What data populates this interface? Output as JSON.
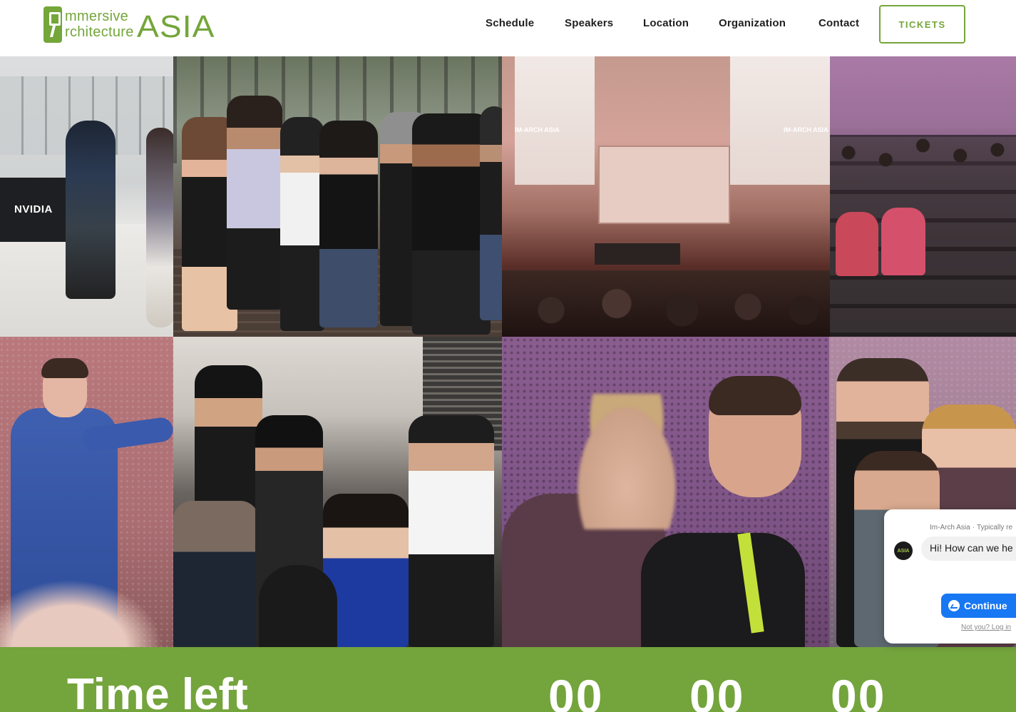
{
  "header": {
    "logo": {
      "line1": "mmersive",
      "line2": "rchitecture",
      "asia": "ASIA"
    },
    "nav": [
      {
        "label": "Schedule"
      },
      {
        "label": "Speakers"
      },
      {
        "label": "Location"
      },
      {
        "label": "Organization"
      },
      {
        "label": "Contact"
      }
    ],
    "tickets_label": "TICKETS"
  },
  "gallery": {
    "photo1_sign": "NVIDIA",
    "photo3_screen_label": "IM-ARCH ASIA"
  },
  "countdown": {
    "title": "Time left",
    "values": [
      "00",
      "00",
      "00"
    ]
  },
  "chat_widget": {
    "page_name": "Im-Arch Asia",
    "reply_status": "Typically re",
    "message": "Hi! How can we he",
    "continue_label": "Continue",
    "login_link": "Not you? Log in"
  },
  "colors": {
    "brand_green": "#74a63a",
    "messenger_blue": "#1877f2"
  }
}
